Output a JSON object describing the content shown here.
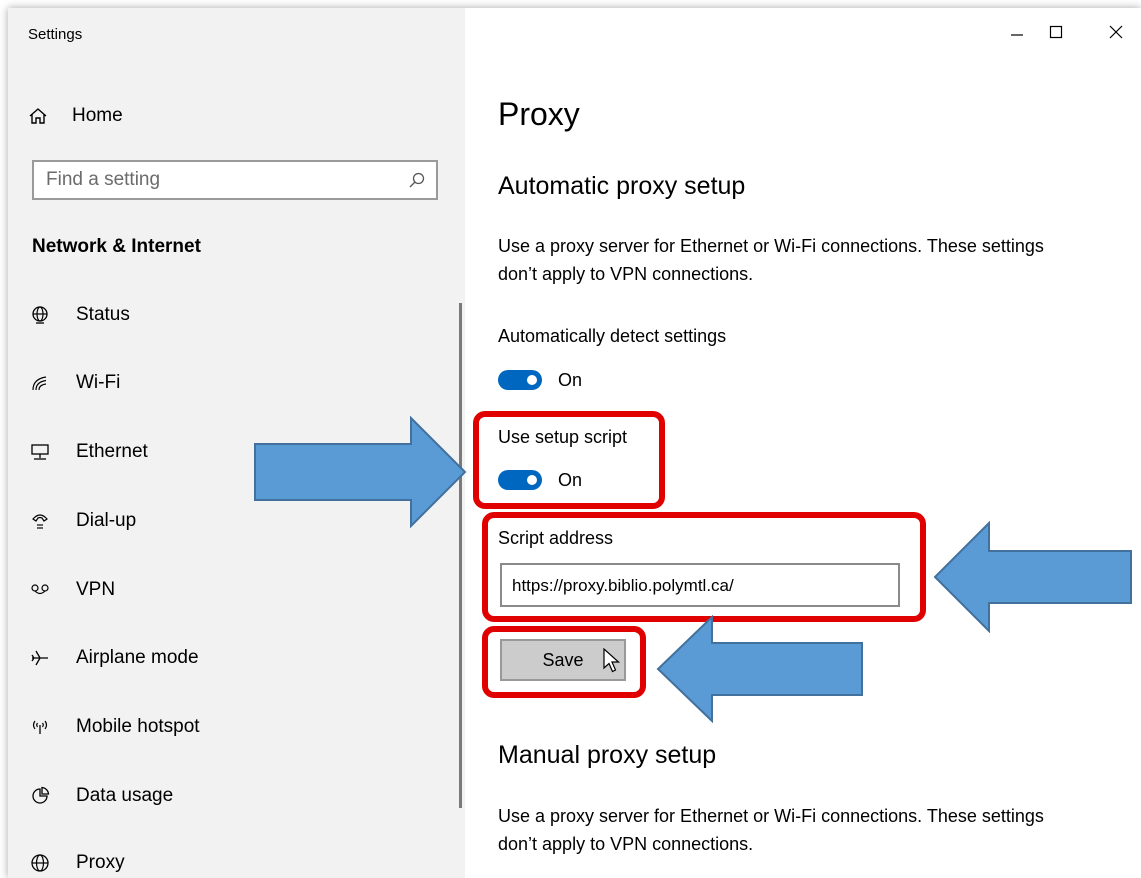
{
  "window": {
    "title": "Settings"
  },
  "sidebar": {
    "home_label": "Home",
    "search_placeholder": "Find a setting",
    "section_title": "Network & Internet",
    "items": [
      {
        "label": "Status",
        "icon": "globe-status-icon"
      },
      {
        "label": "Wi-Fi",
        "icon": "wifi-icon"
      },
      {
        "label": "Ethernet",
        "icon": "ethernet-icon"
      },
      {
        "label": "Dial-up",
        "icon": "dialup-icon"
      },
      {
        "label": "VPN",
        "icon": "vpn-icon"
      },
      {
        "label": "Airplane mode",
        "icon": "airplane-icon"
      },
      {
        "label": "Mobile hotspot",
        "icon": "hotspot-icon"
      },
      {
        "label": "Data usage",
        "icon": "data-usage-icon"
      },
      {
        "label": "Proxy",
        "icon": "globe-icon"
      }
    ]
  },
  "main": {
    "title": "Proxy",
    "automatic": {
      "heading": "Automatic proxy setup",
      "description": "Use a proxy server for Ethernet or Wi-Fi connections. These settings don’t apply to VPN connections.",
      "detect_label": "Automatically detect settings",
      "detect_state": "On",
      "script_label": "Use setup script",
      "script_state": "On",
      "address_label": "Script address",
      "address_value": "https://proxy.biblio.polymtl.ca/",
      "save_label": "Save"
    },
    "manual": {
      "heading": "Manual proxy setup",
      "description": "Use a proxy server for Ethernet or Wi-Fi connections. These settings don’t apply to VPN connections."
    }
  },
  "colors": {
    "accent": "#0067c0",
    "highlight": "#e00000",
    "arrow_fill": "#5b9bd5",
    "arrow_stroke": "#41719c"
  }
}
